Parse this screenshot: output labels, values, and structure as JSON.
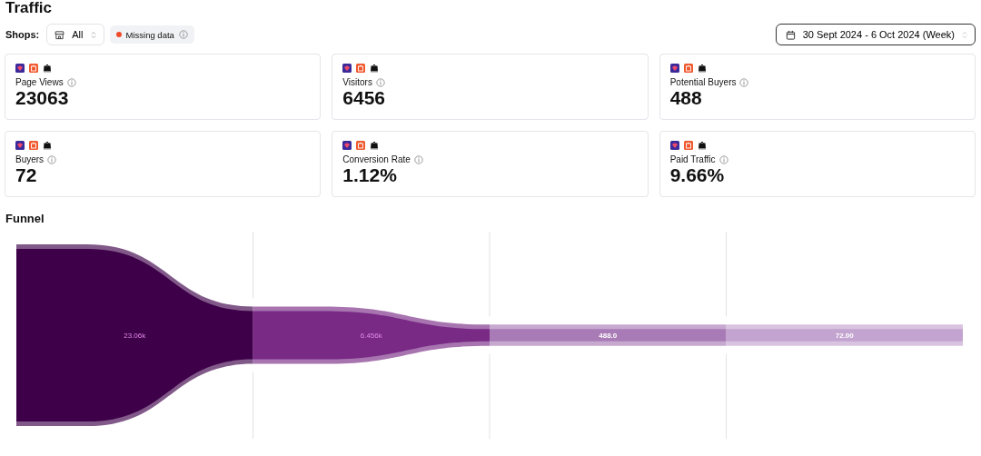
{
  "title": "Traffic",
  "filters": {
    "shops_label": "Shops:",
    "shop_select": "All",
    "missing_badge": {
      "label": "Missing data",
      "color": "#f04a2a"
    },
    "date_range": "30 Sept 2024 - 6 Oct 2024 (Week)"
  },
  "metrics": [
    {
      "label": "Page Views",
      "value": "23063"
    },
    {
      "label": "Visitors",
      "value": "6456"
    },
    {
      "label": "Potential Buyers",
      "value": "488"
    },
    {
      "label": "Buyers",
      "value": "72"
    },
    {
      "label": "Conversion Rate",
      "value": "1.12%"
    },
    {
      "label": "Paid Traffic",
      "value": "9.66%"
    }
  ],
  "funnel": {
    "title": "Funnel",
    "stages": [
      {
        "label": "23.06k",
        "color": "#3d0049"
      },
      {
        "label": "6.456k",
        "color": "#782a85"
      },
      {
        "label": "488.0",
        "color": "#a97bb6"
      },
      {
        "label": "72.00",
        "color": "#c3a3cf"
      }
    ]
  }
}
